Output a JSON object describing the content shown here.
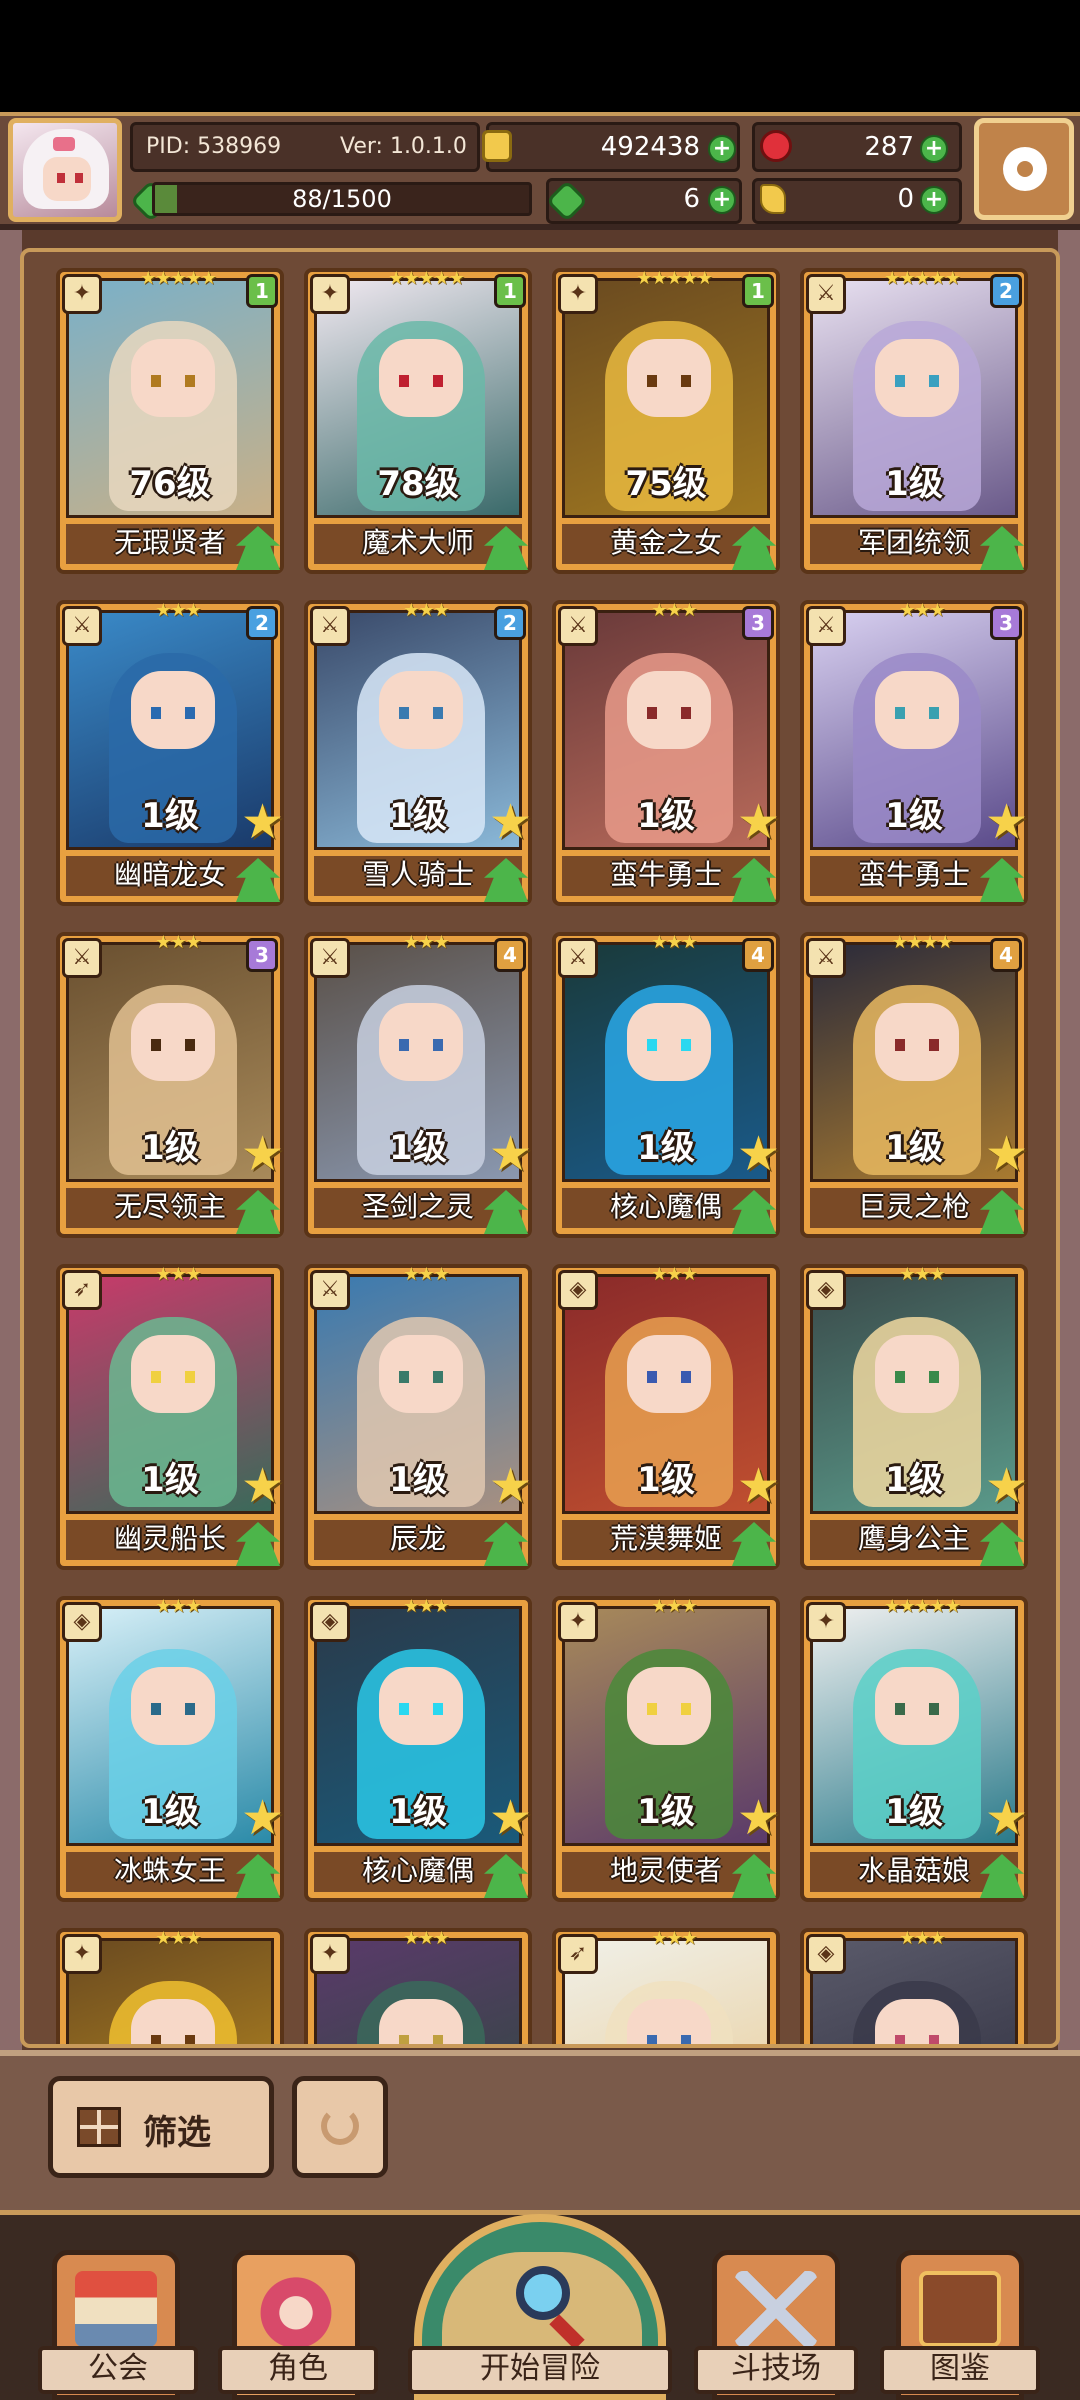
{
  "header": {
    "pid": "PID: 538969",
    "version": "Ver: 1.0.1.0",
    "gold": "492438",
    "gems": "287",
    "stamina_text": "88/1500",
    "stamina_fraction": 0.0587,
    "clover": "6",
    "horn": "0"
  },
  "colors": {
    "rank1": "#6bbf4a",
    "rank2": "#4aa0e0",
    "rank3": "#a77ad8",
    "rank4": "#e0a040"
  },
  "cards": [
    {
      "name": "无瑕贤者",
      "level": "76级",
      "stars": "★★★★★",
      "rank": "1",
      "class": "wand",
      "palette": [
        "#e8d8c0",
        "#c8b088",
        "#7ab0c8"
      ],
      "eye": "#b07a20",
      "show_star": false
    },
    {
      "name": "魔术大师",
      "level": "78级",
      "stars": "★★★★★",
      "rank": "1",
      "class": "wand",
      "palette": [
        "#6ab8a8",
        "#3a6a6a",
        "#f0e8f0"
      ],
      "eye": "#c02030",
      "show_star": false
    },
    {
      "name": "黄金之女",
      "level": "75级",
      "stars": "★★★★★",
      "rank": "1",
      "class": "wand",
      "palette": [
        "#e8b840",
        "#a07820",
        "#6a4a20"
      ],
      "eye": "#6a3a10",
      "show_star": false
    },
    {
      "name": "军团统领",
      "level": "1级",
      "stars": "★★★★★",
      "rank": "2",
      "class": "sword",
      "palette": [
        "#b8a8d8",
        "#6a5a8a",
        "#e8e0f0"
      ],
      "eye": "#3aa0c0",
      "show_star": false
    },
    {
      "name": "幽暗龙女",
      "level": "1级",
      "stars": "★★★",
      "rank": "2",
      "class": "sword",
      "palette": [
        "#2a6aa8",
        "#1a3a6a",
        "#3a8ac8"
      ],
      "eye": "#2a6ab0",
      "show_star": true
    },
    {
      "name": "雪人骑士",
      "level": "1级",
      "stars": "★★★",
      "rank": "2",
      "class": "sword",
      "palette": [
        "#d8e8f8",
        "#8ab8d8",
        "#3a4a6a"
      ],
      "eye": "#3a7ab0",
      "show_star": true
    },
    {
      "name": "蛮牛勇士",
      "level": "1级",
      "stars": "★★★",
      "rank": "3",
      "class": "sword",
      "palette": [
        "#e89a8a",
        "#b86a5a",
        "#6a3a3a"
      ],
      "eye": "#8a2a2a",
      "show_star": true
    },
    {
      "name": "蛮牛勇士",
      "level": "1级",
      "stars": "★★★",
      "rank": "3",
      "class": "sword",
      "palette": [
        "#9a8ac8",
        "#5a4a8a",
        "#d8d0f0"
      ],
      "eye": "#3aa0b0",
      "show_star": true
    },
    {
      "name": "无尽领主",
      "level": "1级",
      "stars": "★★★",
      "rank": "3",
      "class": "sword",
      "palette": [
        "#e0c090",
        "#a88a5a",
        "#6a5030"
      ],
      "eye": "#4a2a10",
      "show_star": true
    },
    {
      "name": "圣剑之灵",
      "level": "1级",
      "stars": "★★★",
      "rank": "4",
      "class": "sword",
      "palette": [
        "#c8d0e0",
        "#8a98b0",
        "#5a5048"
      ],
      "eye": "#3a6ab0",
      "show_star": true
    },
    {
      "name": "核心魔偶",
      "level": "1级",
      "stars": "★★★",
      "rank": "4",
      "class": "sword",
      "palette": [
        "#2aa8e8",
        "#1a5a8a",
        "#1a3a3a"
      ],
      "eye": "#2ad8f0",
      "show_star": true
    },
    {
      "name": "巨灵之枪",
      "level": "1级",
      "stars": "★★★★",
      "rank": "4",
      "class": "sword",
      "palette": [
        "#e8b860",
        "#a87a30",
        "#2a2a3a"
      ],
      "eye": "#8a2a2a",
      "show_star": true
    },
    {
      "name": "幽灵船长",
      "level": "1级",
      "stars": "★★★",
      "rank": "",
      "class": "bow",
      "palette": [
        "#6ab890",
        "#3a6a5a",
        "#c83a6a"
      ],
      "eye": "#f0d040",
      "show_star": true
    },
    {
      "name": "辰龙",
      "level": "1级",
      "stars": "★★★",
      "rank": "",
      "class": "sword",
      "palette": [
        "#e0c8b0",
        "#a89080",
        "#3a7ab0"
      ],
      "eye": "#3a7a6a",
      "show_star": true
    },
    {
      "name": "荒漠舞姬",
      "level": "1级",
      "stars": "★★★",
      "rank": "",
      "class": "shield",
      "palette": [
        "#e8a050",
        "#c05030",
        "#8a2a2a"
      ],
      "eye": "#3a5ab0",
      "show_star": true
    },
    {
      "name": "鹰身公主",
      "level": "1级",
      "stars": "★★★",
      "rank": "",
      "class": "shield",
      "palette": [
        "#f0d8a0",
        "#5a9a8a",
        "#3a4a4a"
      ],
      "eye": "#3a8a4a",
      "show_star": true
    },
    {
      "name": "冰蛛女王",
      "level": "1级",
      "stars": "★★★",
      "rank": "",
      "class": "shield",
      "palette": [
        "#6ad0e8",
        "#2a8aa8",
        "#d8f0f8"
      ],
      "eye": "#2a6a8a",
      "show_star": true
    },
    {
      "name": "核心魔偶",
      "level": "1级",
      "stars": "★★★",
      "rank": "",
      "class": "shield",
      "palette": [
        "#2ac8e8",
        "#1a5a7a",
        "#2a3a4a"
      ],
      "eye": "#2ad8f0",
      "show_star": true
    },
    {
      "name": "地灵使者",
      "level": "1级",
      "stars": "★★★",
      "rank": "",
      "class": "wand",
      "palette": [
        "#4a8a3a",
        "#5a3a6a",
        "#a88a5a"
      ],
      "eye": "#f0d040",
      "show_star": true
    },
    {
      "name": "水晶菇娘",
      "level": "1级",
      "stars": "★★★★★",
      "rank": "",
      "class": "wand",
      "palette": [
        "#5ad0c8",
        "#2a7a8a",
        "#f0f0f0"
      ],
      "eye": "#3a6a4a",
      "show_star": true
    },
    {
      "name": "",
      "level": "",
      "stars": "★★★",
      "rank": "",
      "class": "wand",
      "palette": [
        "#f0c030",
        "#c09020",
        "#6a4a20"
      ],
      "eye": "#6a3a10",
      "show_star": false
    },
    {
      "name": "",
      "level": "",
      "stars": "★★★",
      "rank": "",
      "class": "wand",
      "palette": [
        "#3a6a5a",
        "#2a4a3a",
        "#5a3a6a"
      ],
      "eye": "#c0a040",
      "show_star": false
    },
    {
      "name": "",
      "level": "",
      "stars": "★★★",
      "rank": "",
      "class": "bow",
      "palette": [
        "#f0e0c0",
        "#e8c890",
        "#f0f0e8"
      ],
      "eye": "#3a6ab0",
      "show_star": false
    },
    {
      "name": "",
      "level": "",
      "stars": "★★★",
      "rank": "",
      "class": "shield",
      "palette": [
        "#3a3a4a",
        "#2a2a3a",
        "#5a5a6a"
      ],
      "eye": "#c04a6a",
      "show_star": false
    }
  ],
  "filter": {
    "label": "筛选"
  },
  "nav": {
    "guild": "公会",
    "role": "角色",
    "adventure": "开始冒险",
    "arena": "斗技场",
    "codex": "图鉴"
  }
}
